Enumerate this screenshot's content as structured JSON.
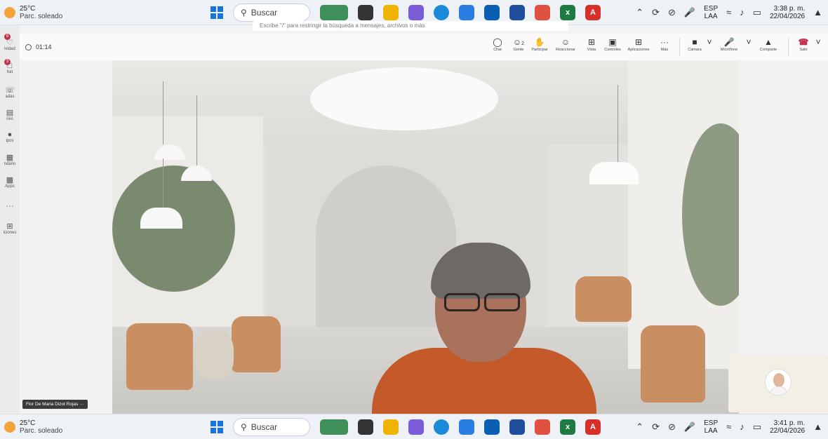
{
  "taskbar_top": {
    "weather_temp": "25°C",
    "weather_desc": "Parc. soleado",
    "search_label": "Buscar",
    "lang_top": "ESP",
    "lang_bottom": "LAA",
    "time": "3:38 p. m.",
    "date": "22/04/2026"
  },
  "teams": {
    "search_placeholder": "Escribe \"/\" para restringir la búsqueda a mensajes, archivos o más",
    "timer": "01:14",
    "sidebar": [
      {
        "label": "ividad",
        "badge": "6"
      },
      {
        "label": "hat",
        "badge": "3"
      },
      {
        "label": "adas"
      },
      {
        "label": "nes"
      },
      {
        "label": "ipos"
      },
      {
        "label": "ndario"
      },
      {
        "label": "Apps"
      },
      {
        "label": ""
      },
      {
        "label": "iciones"
      }
    ],
    "toolbar": {
      "chat": "Chat",
      "people": "Gente",
      "people_count": "2",
      "raise": "Participar",
      "react": "Reaccionar",
      "view": "Vista",
      "controls": "Controles",
      "apps": "Aplicaciones",
      "more": "Más",
      "camera": "Cámara",
      "mic": "Micrófono",
      "share": "Comparte",
      "leave": "Salir"
    },
    "participant_name": "Flor De Maria Dizot Rojas",
    "participant_more": "···"
  },
  "taskbar_bottom": {
    "weather_temp": "25°C",
    "weather_desc": "Parc. soleado",
    "search_label": "Buscar",
    "lang_top": "ESP",
    "lang_bottom": "LAA",
    "time": "3:41 p. m.",
    "date": "22/04/2026"
  },
  "colors": {
    "accent_blue": "#1a73d9",
    "leave_red": "#c4314b",
    "shirt": "#c45a2a"
  }
}
